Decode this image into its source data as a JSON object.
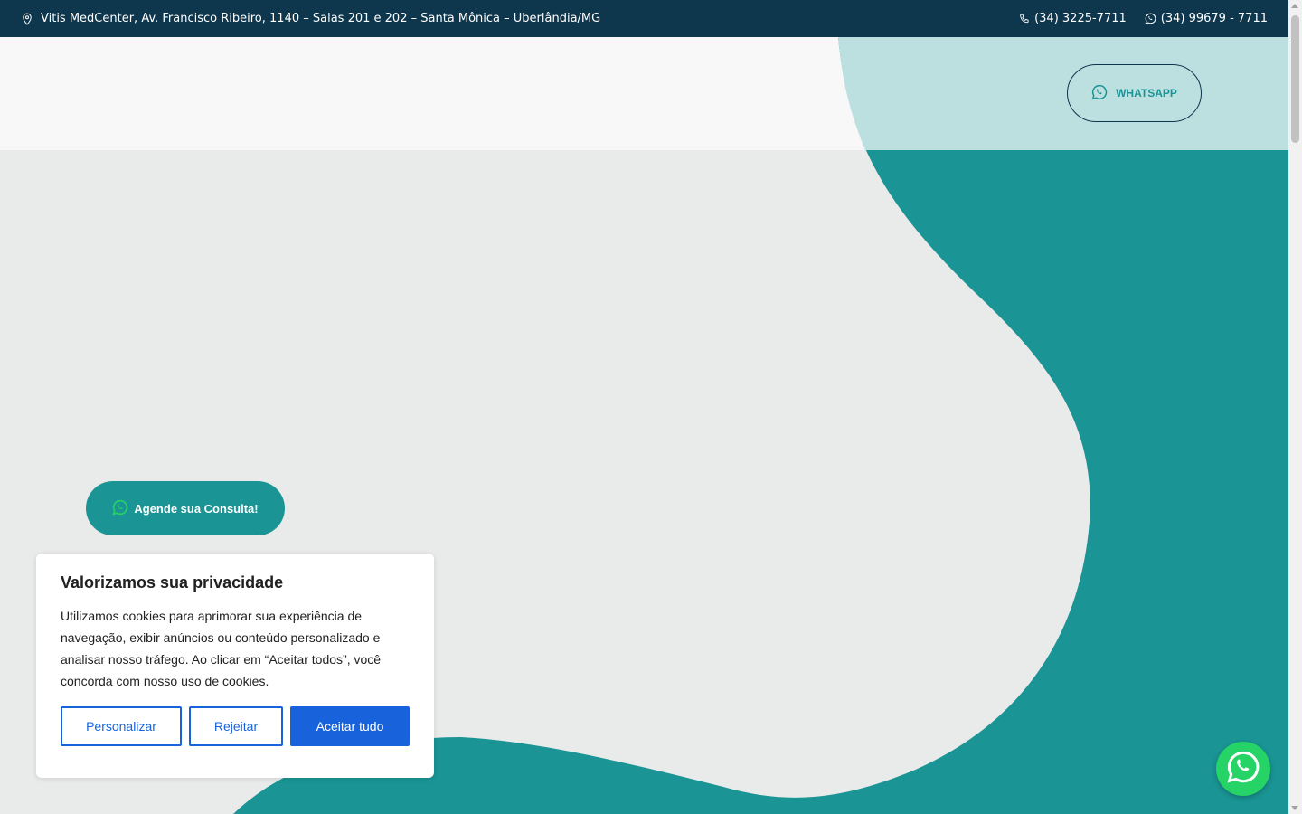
{
  "topbar": {
    "address": "Vitis MedCenter, Av. Francisco Ribeiro, 1140 – Salas 201 e 202 – Santa Mônica – Uberlândia/MG",
    "phone": "(34) 3225-7711",
    "whatsapp": "(34) 99679 - 7711",
    "icons": [
      "location-pin-icon",
      "phone-icon",
      "whatsapp-icon"
    ]
  },
  "header": {
    "whatsapp_button_label": "WHATSAPP"
  },
  "hero": {
    "cta_label": "Agende sua Consulta!"
  },
  "cookie_banner": {
    "title": "Valorizamos sua privacidade",
    "text": "Utilizamos cookies para aprimorar sua experiência de navegação, exibir anúncios ou conteúdo personalizado e analisar nosso tráfego. Ao clicar em “Aceitar todos”, você concorda com nosso uso de cookies.",
    "customize_label": "Personalizar",
    "reject_label": "Rejeitar",
    "accept_label": "Aceitar tudo"
  },
  "colors": {
    "topbar": "#0e364c",
    "teal": "#1a9494",
    "light_teal": "#bce0e0",
    "header_bg": "#f8f8f8",
    "hero_bg": "#e9eaea",
    "cookie_accent": "#1863dc",
    "whatsapp_green": "#25d366"
  }
}
